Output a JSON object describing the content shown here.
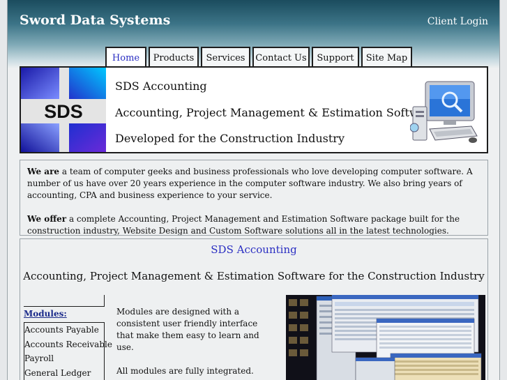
{
  "header": {
    "site_title": "Sword Data Systems",
    "client_login": "Client Login"
  },
  "nav": {
    "tabs": [
      {
        "label": "Home",
        "active": true
      },
      {
        "label": "Products",
        "active": false
      },
      {
        "label": "Services",
        "active": false
      },
      {
        "label": "Contact Us",
        "active": false
      },
      {
        "label": "Support",
        "active": false
      },
      {
        "label": "Site Map",
        "active": false
      }
    ]
  },
  "hero": {
    "logo_text": "SDS",
    "line1": "SDS Accounting",
    "line2": "Accounting, Project Management & Estimation Software",
    "line3": "Developed for the Construction Industry"
  },
  "intro": {
    "p1_lead": "We are",
    "p1_text": " a team of computer geeks and business professionals who love developing computer software. A number of us have over 20 years experience in the computer software industry. We also bring years of accounting, CPA and business experience to your service.",
    "p2_lead": "We offer",
    "p2_text": " a complete Accounting, Project Management and Estimation Software package built for the construction industry, Website Design and Custom Software solutions all in the latest technologies."
  },
  "product": {
    "title": "SDS Accounting",
    "subtitle": "Accounting, Project Management & Estimation Software for the Construction Industry",
    "modules_label": "Modules:",
    "modules": [
      "Accounts Payable",
      "Accounts Receivable",
      "Payroll",
      "General Ledger"
    ],
    "text1": "Modules are designed with a consistent user friendly interface that make them easy to learn and use.",
    "text2": "All modules are fully integrated."
  },
  "colors": {
    "link_blue": "#2a2ec2",
    "header_dark": "#1b4c5e"
  }
}
